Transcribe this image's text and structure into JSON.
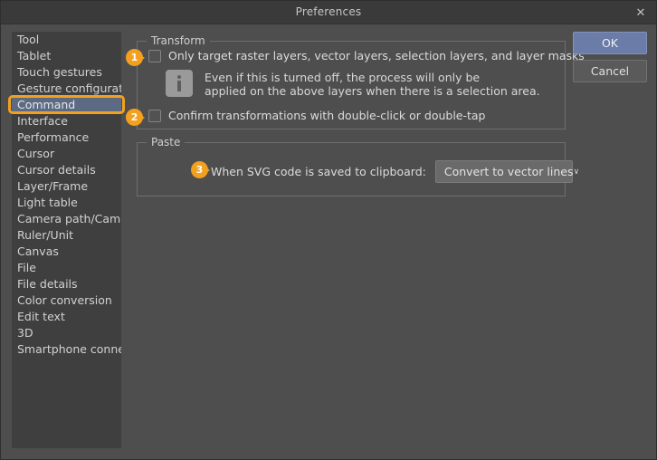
{
  "window": {
    "title": "Preferences",
    "close_icon": "close-icon",
    "close_glyph": "✕"
  },
  "colors": {
    "accent_annotation": "#f2a01e",
    "selection": "#5c6a84",
    "ok_button": "#6b7ca8",
    "dialog_bg": "#4e4e4e",
    "sidebar_bg": "#3f3f3f",
    "titlebar_bg": "#3a3a3a"
  },
  "sidebar": {
    "selected": "Command",
    "items": [
      {
        "label": "Tool"
      },
      {
        "label": "Tablet"
      },
      {
        "label": "Touch gestures"
      },
      {
        "label": "Gesture configuration"
      },
      {
        "label": "Command"
      },
      {
        "label": "Interface"
      },
      {
        "label": "Performance"
      },
      {
        "label": "Cursor"
      },
      {
        "label": "Cursor details"
      },
      {
        "label": "Layer/Frame"
      },
      {
        "label": "Light table"
      },
      {
        "label": "Camera path/Camera"
      },
      {
        "label": "Ruler/Unit"
      },
      {
        "label": "Canvas"
      },
      {
        "label": "File"
      },
      {
        "label": "File details"
      },
      {
        "label": "Color conversion"
      },
      {
        "label": "Edit text"
      },
      {
        "label": "3D"
      },
      {
        "label": "Smartphone connection"
      }
    ]
  },
  "transform_group": {
    "legend": "Transform",
    "checkbox_only_target": {
      "label": "Only target raster layers, vector layers, selection layers, and layer masks",
      "checked": false
    },
    "info": {
      "icon": "info-icon",
      "line1": "Even if this is turned off, the process will only be",
      "line2": "applied on the above layers when there is a selection area."
    },
    "checkbox_confirm": {
      "label": "Confirm transformations with double-click or double-tap",
      "checked": false
    }
  },
  "paste_group": {
    "legend": "Paste",
    "svg_label": "When SVG code is saved to clipboard:",
    "svg_select": {
      "value": "Convert to vector lines",
      "arrow_glyph": "∨"
    }
  },
  "buttons": {
    "ok": "OK",
    "cancel": "Cancel"
  },
  "annotations": [
    {
      "number": "1",
      "target": "checkbox-only-target"
    },
    {
      "number": "2",
      "target": "checkbox-confirm-transformations"
    },
    {
      "number": "3",
      "target": "svg-clipboard-select"
    }
  ]
}
